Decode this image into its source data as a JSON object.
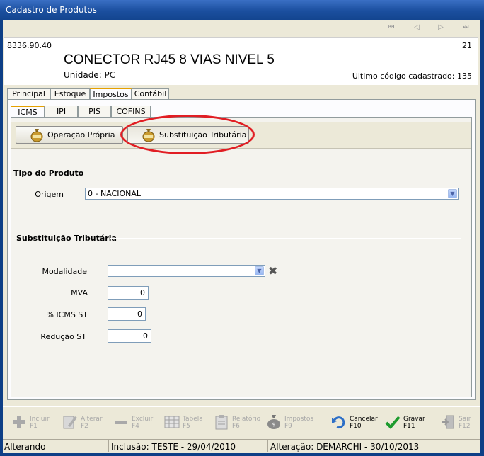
{
  "window": {
    "title": "Cadastro de Produtos"
  },
  "nav": {
    "first": "⏮",
    "prev": "◁",
    "next": "▷",
    "last": "⏭"
  },
  "header": {
    "ncm": "8336.90.40",
    "record_number": "21",
    "product_name": "CONECTOR RJ45 8 VIAS NIVEL 5",
    "unidade": "Unidade:  PC",
    "ultimo_codigo": "Último código cadastrado: 135"
  },
  "tabs": [
    "Principal",
    "Estoque",
    "Impostos",
    "Contábil"
  ],
  "subtabs": [
    "ICMS",
    "IPI",
    "PIS",
    "COFINS"
  ],
  "operations": {
    "propria": "Operação Própria",
    "st": "Substituição Tributária"
  },
  "tipo_produto": {
    "title": "Tipo do Produto",
    "origem_label": "Origem",
    "origem_value": "0 - NACIONAL"
  },
  "substituicao": {
    "title": "Substituição Tributária",
    "modalidade_label": "Modalidade",
    "modalidade_value": "",
    "mva_label": "MVA",
    "mva_value": "0",
    "icms_st_label": "% ICMS ST",
    "icms_st_value": "0",
    "reducao_label": "Redução ST",
    "reducao_value": "0"
  },
  "toolbar": {
    "incluir": "Incluir",
    "incluir_key": "F1",
    "alterar": "Alterar",
    "alterar_key": "F2",
    "excluir": "Excluir",
    "excluir_key": "F4",
    "tabela": "Tabela",
    "tabela_key": "F5",
    "relatorio": "Relatório",
    "relatorio_key": "F6",
    "impostos": "Impostos",
    "impostos_key": "F9",
    "cancelar": "Cancelar",
    "cancelar_key": "F10",
    "gravar": "Gravar",
    "gravar_key": "F11",
    "sair": "Sair",
    "sair_key": "F12"
  },
  "status": {
    "mode": "Alterando",
    "inclusao": "Inclusão: TESTE - 29/04/2010",
    "alteracao": "Alteração: DEMARCHI - 30/10/2013"
  },
  "colors": {
    "highlight": "#e11d23",
    "titlebar": "#1b4f9f",
    "accent_tab": "#e5a000"
  }
}
